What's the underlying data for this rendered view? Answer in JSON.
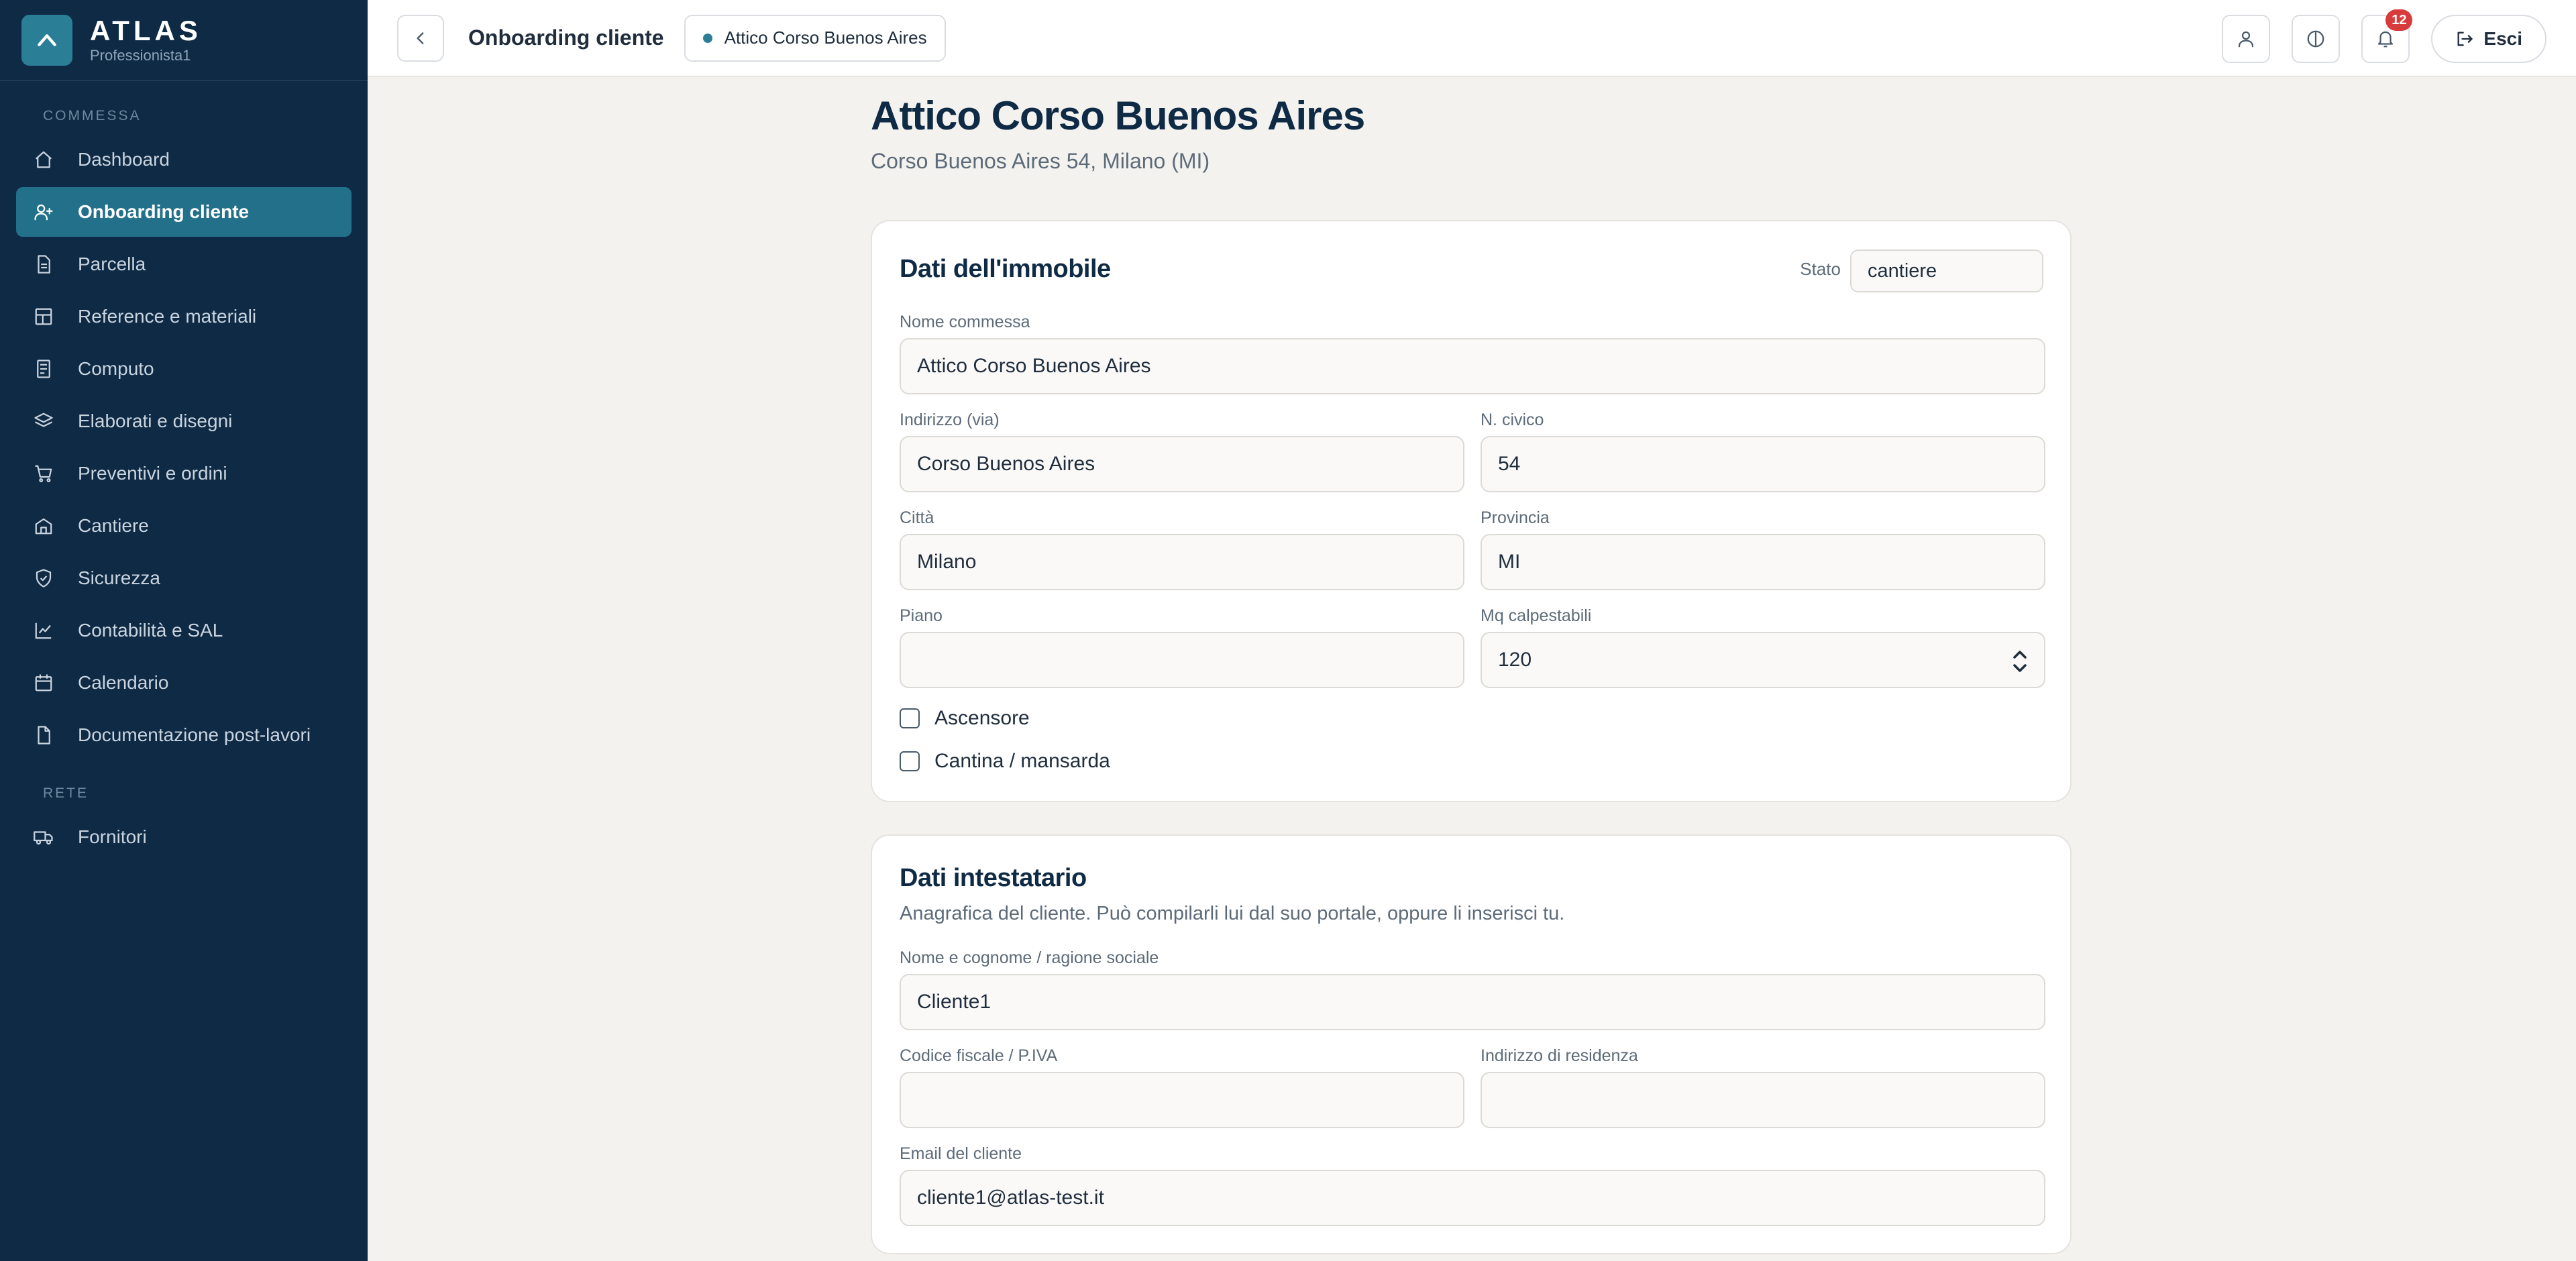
{
  "brand": {
    "name": "ATLAS",
    "subtitle": "Professionista1"
  },
  "sidebar": {
    "section_commessa": "COMMESSA",
    "items": [
      {
        "label": "Dashboard",
        "icon": "home-icon"
      },
      {
        "label": "Onboarding cliente",
        "icon": "user-plus-icon",
        "active": true
      },
      {
        "label": "Parcella",
        "icon": "file-icon"
      },
      {
        "label": "Reference e materiali",
        "icon": "grid-icon"
      },
      {
        "label": "Computo",
        "icon": "calculator-icon"
      },
      {
        "label": "Elaborati e disegni",
        "icon": "layers-icon"
      },
      {
        "label": "Preventivi e ordini",
        "icon": "cart-icon"
      },
      {
        "label": "Cantiere",
        "icon": "building-icon"
      },
      {
        "label": "Sicurezza",
        "icon": "shield-icon"
      },
      {
        "label": "Contabilità e SAL",
        "icon": "chart-line-icon"
      },
      {
        "label": "Calendario",
        "icon": "calendar-icon"
      },
      {
        "label": "Documentazione post-lavori",
        "icon": "document-icon"
      }
    ],
    "section_rete": "RETE",
    "rete_items": [
      {
        "label": "Fornitori",
        "icon": "truck-icon"
      }
    ]
  },
  "topbar": {
    "title": "Onboarding cliente",
    "project_chip": "Attico Corso Buenos Aires",
    "notifications_count": "12",
    "logout_label": "Esci"
  },
  "page": {
    "title": "Attico Corso Buenos Aires",
    "subtitle": "Corso Buenos Aires 54, Milano (MI)"
  },
  "immobile": {
    "title": "Dati dell'immobile",
    "stato_label": "Stato",
    "stato_value": "cantiere",
    "nome_label": "Nome commessa",
    "nome_value": "Attico Corso Buenos Aires",
    "indirizzo_label": "Indirizzo (via)",
    "indirizzo_value": "Corso Buenos Aires",
    "civico_label": "N. civico",
    "civico_value": "54",
    "citta_label": "Città",
    "citta_value": "Milano",
    "provincia_label": "Provincia",
    "provincia_value": "MI",
    "piano_label": "Piano",
    "piano_value": "",
    "mq_label": "Mq calpestabili",
    "mq_value": "120",
    "ascensore_label": "Ascensore",
    "cantina_label": "Cantina / mansarda"
  },
  "intestatario": {
    "title": "Dati intestatario",
    "description": "Anagrafica del cliente. Può compilarli lui dal suo portale, oppure li inserisci tu.",
    "nome_label": "Nome e cognome / ragione sociale",
    "nome_value": "Cliente1",
    "cf_label": "Codice fiscale / P.IVA",
    "cf_value": "",
    "residenza_label": "Indirizzo di residenza",
    "residenza_value": "",
    "email_label": "Email del cliente",
    "email_value": "cliente1@atlas-test.it"
  }
}
